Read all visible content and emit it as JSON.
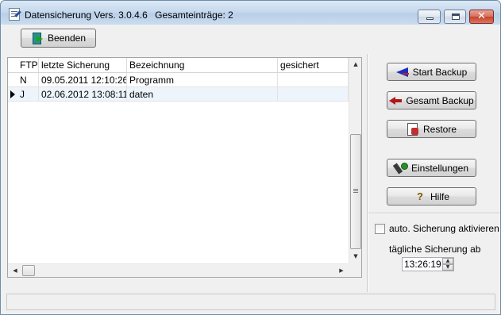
{
  "window": {
    "title": "Datensicherung Vers. 3.0.4.6",
    "entries_label": "Gesamteinträge: 2"
  },
  "titlebar_buttons": {
    "minimize": "",
    "maximize": "",
    "close": "✕"
  },
  "toolbar": {
    "exit_label": "Beenden"
  },
  "grid": {
    "columns": [
      "FTP",
      "letzte Sicherung",
      "Bezeichnung",
      "gesichert"
    ],
    "rows": [
      {
        "ftp": "N",
        "date": "09.05.2011 12:10:26",
        "name": "Programm",
        "saved": ""
      },
      {
        "ftp": "J",
        "date": "02.06.2012 13:08:11",
        "name": "daten",
        "saved": ""
      }
    ],
    "selected_row": 1
  },
  "buttons": {
    "start_backup": "Start Backup",
    "full_backup": "Gesamt Backup",
    "restore": "Restore",
    "settings": "Einstellungen",
    "help": "Hilfe"
  },
  "schedule": {
    "auto_label": "auto. Sicherung aktivieren",
    "auto_checked": false,
    "daily_label": "tägliche Sicherung ab",
    "time_value": "13:26:19"
  },
  "icons": {
    "exit": "exit-door-icon",
    "start": "start-arrow-icon",
    "full": "full-backup-arrow-icon",
    "restore": "restore-icon",
    "settings": "tools-icon",
    "help": "help-icon"
  },
  "help_glyph": "?",
  "scroll_glyphs": {
    "up": "▲",
    "down": "▼",
    "left": "◀",
    "right": "▶"
  }
}
